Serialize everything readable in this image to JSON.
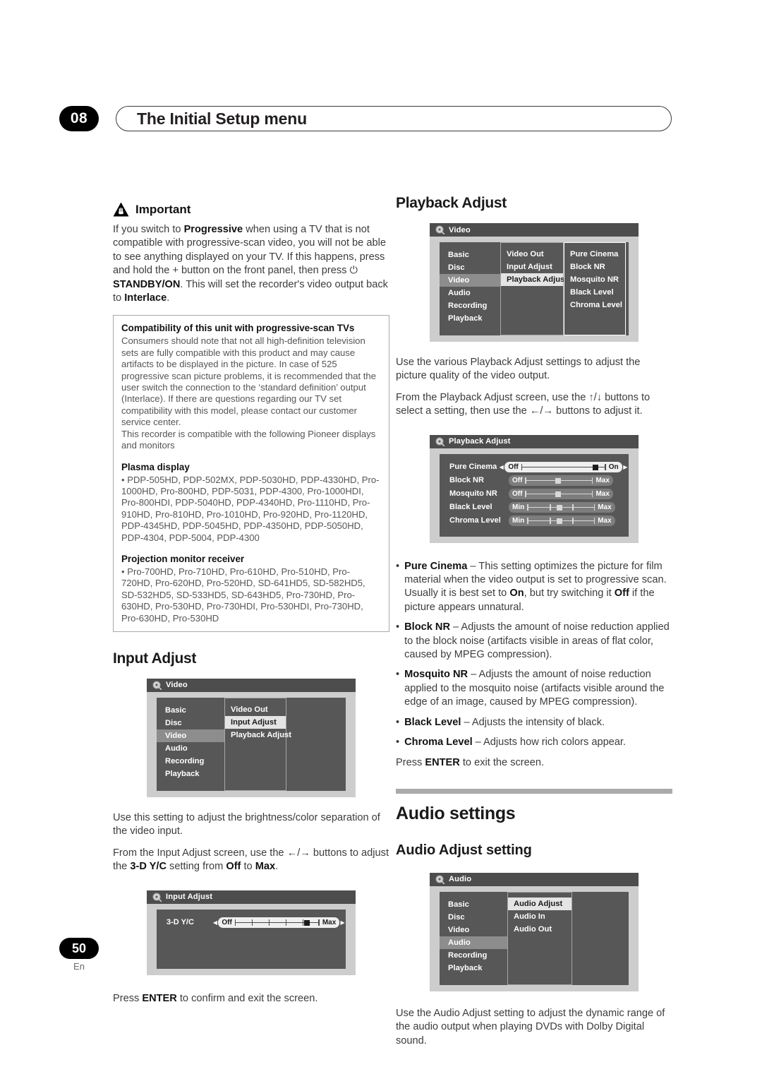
{
  "header": {
    "chapter_number": "08",
    "title": "The Initial Setup menu"
  },
  "footer": {
    "page_number": "50",
    "language": "En"
  },
  "left_column": {
    "important": {
      "icon": "warning-triangle-icon",
      "label": "Important",
      "body": "If you switch to Progressive when using a TV that is not compatible with progressive-scan video, you will not be able to see anything displayed on your TV. If this happens, press and hold the + button on the front panel, then press ⏻ STANDBY/ON. This will set the recorder's video output back to Interlace."
    },
    "infobox": {
      "title": "Compatibility of this unit with progressive-scan TVs",
      "para1": "Consumers should note that not all high-definition television sets are fully compatible with this product and may cause artifacts to be displayed in the picture. In case of 525 progressive scan picture problems, it is recommended that the user switch the connection to the ‘standard definition’ output (Interlace). If there are questions regarding our TV set compatibility with this model, please contact our customer service center.",
      "para2": "This recorder is compatible with the following Pioneer displays and monitors",
      "plasma_title": "Plasma display",
      "plasma_list": "• PDP-505HD, PDP-502MX, PDP-5030HD, PDP-4330HD, Pro-1000HD, Pro-800HD, PDP-5031, PDP-4300, Pro-1000HDI, Pro-800HDI, PDP-5040HD, PDP-4340HD, Pro-1110HD, Pro-910HD, Pro-810HD, Pro-1010HD, Pro-920HD, Pro-1120HD, PDP-4345HD, PDP-5045HD, PDP-4350HD, PDP-5050HD, PDP-4304, PDP-5004, PDP-4300",
      "projection_title": "Projection monitor receiver",
      "projection_list": "• Pro-700HD, Pro-710HD, Pro-610HD, Pro-510HD, Pro-720HD, Pro-620HD, Pro-520HD, SD-641HD5, SD-582HD5, SD-532HD5, SD-533HD5, SD-643HD5, Pro-730HD, Pro-630HD, Pro-530HD, Pro-730HDI, Pro-530HDI, Pro-730HD, Pro-630HD, Pro-530HD"
    },
    "input_adjust": {
      "heading": "Input Adjust",
      "menu": {
        "titlebar": "Video",
        "titlebar_icon": "disc-icon",
        "column1": [
          "Basic",
          "Disc",
          "Video",
          "Audio",
          "Recording",
          "Playback"
        ],
        "column1_selected": "Video",
        "column2": [
          "Video Out",
          "Input Adjust",
          "Playback Adjust"
        ],
        "column2_selected": "Input Adjust"
      },
      "para1": "Use this setting to adjust the brightness/color separation of the video input.",
      "para2": "From the Input Adjust screen, use the ←/→ buttons to adjust the 3-D Y/C setting from Off to Max.",
      "slider_panel": {
        "titlebar": "Input Adjust",
        "titlebar_icon": "disc-icon",
        "rows": [
          {
            "label": "3-D Y/C",
            "left": "Off",
            "right": "Max",
            "ticks": 4,
            "knob_pct": 85,
            "active": true,
            "arrows": true
          }
        ]
      },
      "para3": "Press ENTER to confirm and exit the screen."
    }
  },
  "right_column": {
    "playback_adjust": {
      "heading": "Playback Adjust",
      "menu": {
        "titlebar": "Video",
        "titlebar_icon": "disc-icon",
        "column1": [
          "Basic",
          "Disc",
          "Video",
          "Audio",
          "Recording",
          "Playback"
        ],
        "column1_selected": "Video",
        "column2": [
          "Video Out",
          "Input Adjust",
          "Playback Adjust"
        ],
        "column2_selected": "Playback Adjust",
        "column3": [
          "Pure Cinema",
          "Block NR",
          "Mosquito NR",
          "Black Level",
          "Chroma Level"
        ]
      },
      "para1": "Use the various Playback Adjust settings to adjust the picture quality of the video output.",
      "para2": "From the Playback Adjust screen, use the ↑/↓ buttons to select a setting, then use the ←/→ buttons to adjust it.",
      "slider_panel": {
        "titlebar": "Playback Adjust",
        "titlebar_icon": "disc-icon",
        "rows": [
          {
            "label": "Pure Cinema",
            "left": "Off",
            "right": "On",
            "ticks": 0,
            "knob_pct": 88,
            "active": true,
            "arrows": true
          },
          {
            "label": "Block NR",
            "left": "Off",
            "right": "Max",
            "ticks": 0,
            "knob_pct": 48,
            "active": false,
            "arrows": false
          },
          {
            "label": "Mosquito NR",
            "left": "Off",
            "right": "Max",
            "ticks": 0,
            "knob_pct": 48,
            "active": false,
            "arrows": false
          },
          {
            "label": "Black Level",
            "left": "Min",
            "right": "Max",
            "ticks": 2,
            "knob_pct": 48,
            "active": false,
            "arrows": false
          },
          {
            "label": "Chroma Level",
            "left": "Min",
            "right": "Max",
            "ticks": 2,
            "knob_pct": 48,
            "active": false,
            "arrows": false
          }
        ]
      },
      "bullets": [
        {
          "term": "Pure Cinema",
          "text": " – This setting optimizes the picture for film material when the video output is set to progressive scan. Usually it is best set to On, but try switching it Off if the picture appears unnatural."
        },
        {
          "term": "Block NR",
          "text": " – Adjusts the amount of noise reduction applied to the block noise (artifacts visible in areas of flat color, caused by MPEG compression)."
        },
        {
          "term": "Mosquito NR",
          "text": " – Adjusts the amount of noise reduction applied to the mosquito noise (artifacts visible around the edge of an image, caused by MPEG compression)."
        },
        {
          "term": "Black Level",
          "text": " – Adjusts the intensity of black."
        },
        {
          "term": "Chroma Level",
          "text": " – Adjusts how rich colors appear."
        }
      ],
      "closing": "Press ENTER to exit the screen."
    },
    "audio_settings": {
      "heading": "Audio settings",
      "sub_heading": "Audio Adjust setting",
      "menu": {
        "titlebar": "Audio",
        "titlebar_icon": "disc-icon",
        "column1": [
          "Basic",
          "Disc",
          "Video",
          "Audio",
          "Recording",
          "Playback"
        ],
        "column1_selected": "Audio",
        "column2": [
          "Audio Adjust",
          "Audio In",
          "Audio Out"
        ],
        "column2_selected": "Audio Adjust"
      },
      "para1": "Use the Audio Adjust setting to adjust the dynamic range of the audio output when playing DVDs with Dolby Digital sound."
    }
  }
}
